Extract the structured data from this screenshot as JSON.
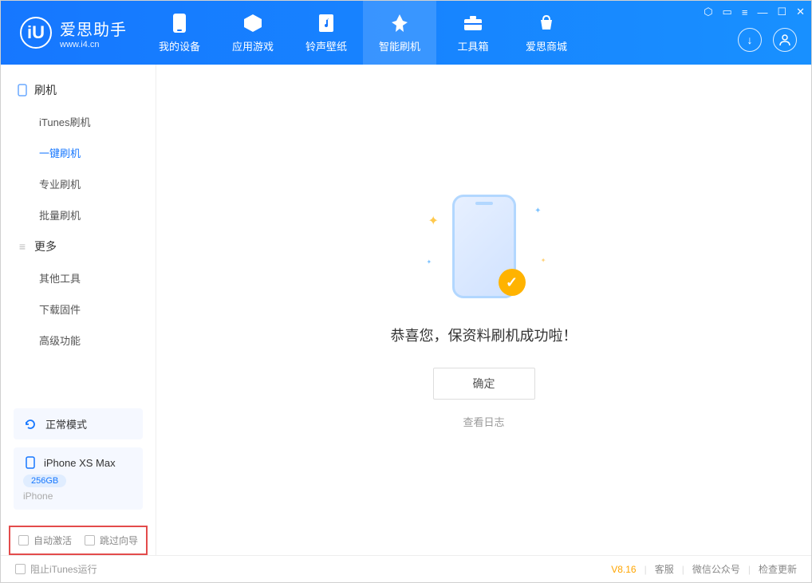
{
  "app": {
    "title": "爱思助手",
    "subtitle": "www.i4.cn",
    "logo_letter": "iU"
  },
  "nav": [
    {
      "label": "我的设备",
      "icon": "device"
    },
    {
      "label": "应用游戏",
      "icon": "apps"
    },
    {
      "label": "铃声壁纸",
      "icon": "music"
    },
    {
      "label": "智能刷机",
      "icon": "flash",
      "active": true
    },
    {
      "label": "工具箱",
      "icon": "toolbox"
    },
    {
      "label": "爱思商城",
      "icon": "shop"
    }
  ],
  "sidebar": {
    "group1_title": "刷机",
    "group1_items": [
      "iTunes刷机",
      "一键刷机",
      "专业刷机",
      "批量刷机"
    ],
    "group1_active_index": 1,
    "group2_title": "更多",
    "group2_items": [
      "其他工具",
      "下载固件",
      "高级功能"
    ]
  },
  "device_status": {
    "mode": "正常模式",
    "name": "iPhone XS Max",
    "storage": "256GB",
    "type": "iPhone"
  },
  "checks": {
    "c1": "自动激活",
    "c2": "跳过向导"
  },
  "main": {
    "message": "恭喜您，保资料刷机成功啦！",
    "ok_button": "确定",
    "view_log": "查看日志"
  },
  "footer": {
    "block_itunes": "阻止iTunes运行",
    "version": "V8.16",
    "link1": "客服",
    "link2": "微信公众号",
    "link3": "检查更新"
  }
}
